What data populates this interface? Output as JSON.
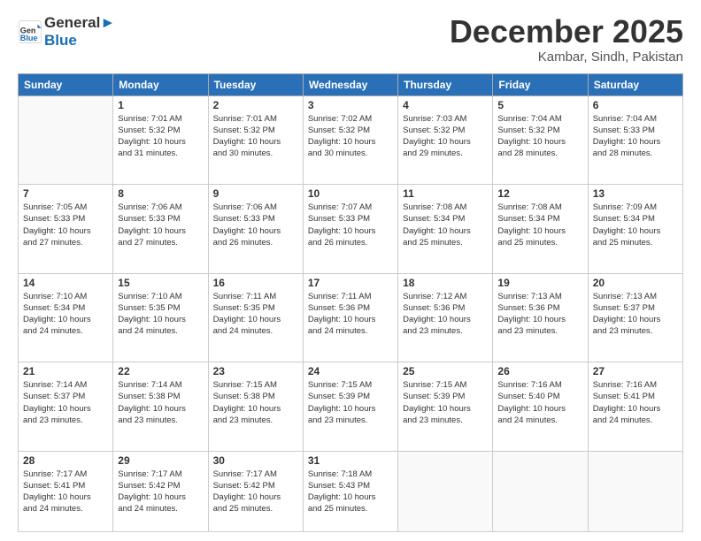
{
  "header": {
    "logo_line1": "General",
    "logo_line2": "Blue",
    "month": "December 2025",
    "location": "Kambar, Sindh, Pakistan"
  },
  "days": [
    "Sunday",
    "Monday",
    "Tuesday",
    "Wednesday",
    "Thursday",
    "Friday",
    "Saturday"
  ],
  "weeks": [
    [
      {
        "date": "",
        "info": ""
      },
      {
        "date": "1",
        "info": "Sunrise: 7:01 AM\nSunset: 5:32 PM\nDaylight: 10 hours\nand 31 minutes."
      },
      {
        "date": "2",
        "info": "Sunrise: 7:01 AM\nSunset: 5:32 PM\nDaylight: 10 hours\nand 30 minutes."
      },
      {
        "date": "3",
        "info": "Sunrise: 7:02 AM\nSunset: 5:32 PM\nDaylight: 10 hours\nand 30 minutes."
      },
      {
        "date": "4",
        "info": "Sunrise: 7:03 AM\nSunset: 5:32 PM\nDaylight: 10 hours\nand 29 minutes."
      },
      {
        "date": "5",
        "info": "Sunrise: 7:04 AM\nSunset: 5:32 PM\nDaylight: 10 hours\nand 28 minutes."
      },
      {
        "date": "6",
        "info": "Sunrise: 7:04 AM\nSunset: 5:33 PM\nDaylight: 10 hours\nand 28 minutes."
      }
    ],
    [
      {
        "date": "7",
        "info": "Sunrise: 7:05 AM\nSunset: 5:33 PM\nDaylight: 10 hours\nand 27 minutes."
      },
      {
        "date": "8",
        "info": "Sunrise: 7:06 AM\nSunset: 5:33 PM\nDaylight: 10 hours\nand 27 minutes."
      },
      {
        "date": "9",
        "info": "Sunrise: 7:06 AM\nSunset: 5:33 PM\nDaylight: 10 hours\nand 26 minutes."
      },
      {
        "date": "10",
        "info": "Sunrise: 7:07 AM\nSunset: 5:33 PM\nDaylight: 10 hours\nand 26 minutes."
      },
      {
        "date": "11",
        "info": "Sunrise: 7:08 AM\nSunset: 5:34 PM\nDaylight: 10 hours\nand 25 minutes."
      },
      {
        "date": "12",
        "info": "Sunrise: 7:08 AM\nSunset: 5:34 PM\nDaylight: 10 hours\nand 25 minutes."
      },
      {
        "date": "13",
        "info": "Sunrise: 7:09 AM\nSunset: 5:34 PM\nDaylight: 10 hours\nand 25 minutes."
      }
    ],
    [
      {
        "date": "14",
        "info": "Sunrise: 7:10 AM\nSunset: 5:34 PM\nDaylight: 10 hours\nand 24 minutes."
      },
      {
        "date": "15",
        "info": "Sunrise: 7:10 AM\nSunset: 5:35 PM\nDaylight: 10 hours\nand 24 minutes."
      },
      {
        "date": "16",
        "info": "Sunrise: 7:11 AM\nSunset: 5:35 PM\nDaylight: 10 hours\nand 24 minutes."
      },
      {
        "date": "17",
        "info": "Sunrise: 7:11 AM\nSunset: 5:36 PM\nDaylight: 10 hours\nand 24 minutes."
      },
      {
        "date": "18",
        "info": "Sunrise: 7:12 AM\nSunset: 5:36 PM\nDaylight: 10 hours\nand 23 minutes."
      },
      {
        "date": "19",
        "info": "Sunrise: 7:13 AM\nSunset: 5:36 PM\nDaylight: 10 hours\nand 23 minutes."
      },
      {
        "date": "20",
        "info": "Sunrise: 7:13 AM\nSunset: 5:37 PM\nDaylight: 10 hours\nand 23 minutes."
      }
    ],
    [
      {
        "date": "21",
        "info": "Sunrise: 7:14 AM\nSunset: 5:37 PM\nDaylight: 10 hours\nand 23 minutes."
      },
      {
        "date": "22",
        "info": "Sunrise: 7:14 AM\nSunset: 5:38 PM\nDaylight: 10 hours\nand 23 minutes."
      },
      {
        "date": "23",
        "info": "Sunrise: 7:15 AM\nSunset: 5:38 PM\nDaylight: 10 hours\nand 23 minutes."
      },
      {
        "date": "24",
        "info": "Sunrise: 7:15 AM\nSunset: 5:39 PM\nDaylight: 10 hours\nand 23 minutes."
      },
      {
        "date": "25",
        "info": "Sunrise: 7:15 AM\nSunset: 5:39 PM\nDaylight: 10 hours\nand 23 minutes."
      },
      {
        "date": "26",
        "info": "Sunrise: 7:16 AM\nSunset: 5:40 PM\nDaylight: 10 hours\nand 24 minutes."
      },
      {
        "date": "27",
        "info": "Sunrise: 7:16 AM\nSunset: 5:41 PM\nDaylight: 10 hours\nand 24 minutes."
      }
    ],
    [
      {
        "date": "28",
        "info": "Sunrise: 7:17 AM\nSunset: 5:41 PM\nDaylight: 10 hours\nand 24 minutes."
      },
      {
        "date": "29",
        "info": "Sunrise: 7:17 AM\nSunset: 5:42 PM\nDaylight: 10 hours\nand 24 minutes."
      },
      {
        "date": "30",
        "info": "Sunrise: 7:17 AM\nSunset: 5:42 PM\nDaylight: 10 hours\nand 25 minutes."
      },
      {
        "date": "31",
        "info": "Sunrise: 7:18 AM\nSunset: 5:43 PM\nDaylight: 10 hours\nand 25 minutes."
      },
      {
        "date": "",
        "info": ""
      },
      {
        "date": "",
        "info": ""
      },
      {
        "date": "",
        "info": ""
      }
    ]
  ]
}
